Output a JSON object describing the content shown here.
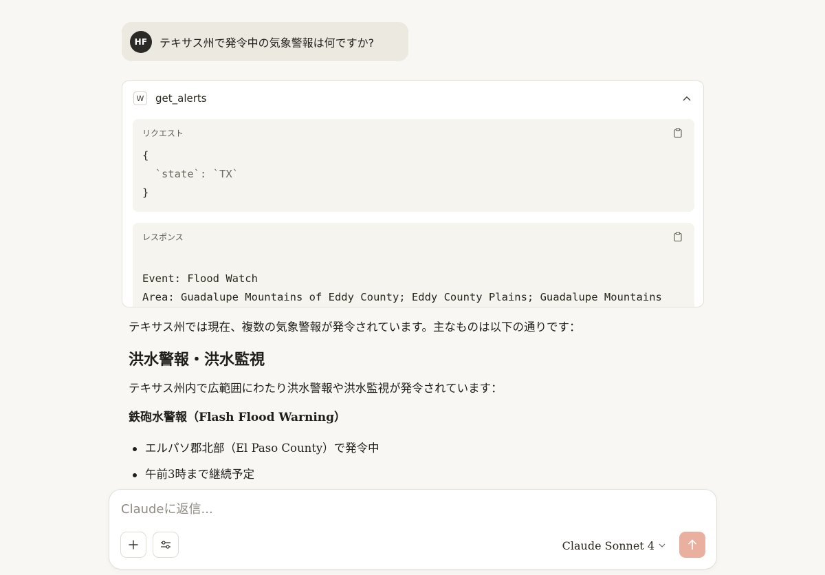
{
  "user_message": {
    "avatar_initials": "HF",
    "text": "テキサス州で発令中の気象警報は何ですか?"
  },
  "tool_call": {
    "icon": "W",
    "name": "get_alerts",
    "collapse_icon": "chevron-up-icon",
    "request": {
      "label": "リクエスト",
      "code_lines": [
        "{",
        "  `state`: `TX`",
        "}"
      ]
    },
    "response": {
      "label": "レスポンス",
      "code_lines": [
        "Event: Flood Watch",
        "Area: Guadalupe Mountains of Eddy County; Eddy County Plains; Guadalupe Mountains"
      ]
    }
  },
  "reply": {
    "intro": "テキサス州では現在、複数の気象警報が発令されています。主なものは以下の通りです：",
    "heading": "洪水警報・洪水監視",
    "subtext": "テキサス州内で広範囲にわたり洪水警報や洪水監視が発令されています：",
    "subheading": "鉄砲水警報（Flash Flood Warning）",
    "bullets": [
      "エルパソ郡北部（El Paso County）で発令中",
      "午前3時まで継続予定"
    ]
  },
  "composer": {
    "placeholder": "Claudeに返信...",
    "model_label": "Claude Sonnet 4",
    "send_color": "#e9b09f"
  }
}
